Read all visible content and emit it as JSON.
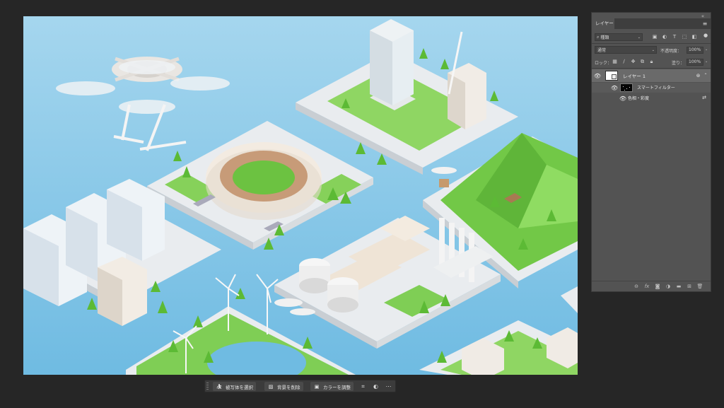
{
  "layers_panel": {
    "tab_label": "レイヤー",
    "filter": {
      "kind_label": "種類"
    },
    "blend_mode": "通常",
    "opacity_label": "不透明度：",
    "opacity_value": "100%",
    "lock_label": "ロック：",
    "fill_label": "塗り：",
    "fill_value": "100%",
    "layers": [
      {
        "name": "レイヤー 1",
        "selected": true,
        "smart_filters_label": "スマートフィルター",
        "filter_name": "色相・彩度"
      }
    ]
  },
  "taskbar": {
    "select_subject_label": "被写体を選択",
    "remove_bg_label": "背景を削除",
    "adjust_color_label": "カラーを調整"
  },
  "colors": {
    "app_bg": "#262626",
    "panel_bg": "#535353",
    "selected_layer": "#6a6a6a",
    "water": "#8ecbe6",
    "grass": "#7ccf4e"
  }
}
